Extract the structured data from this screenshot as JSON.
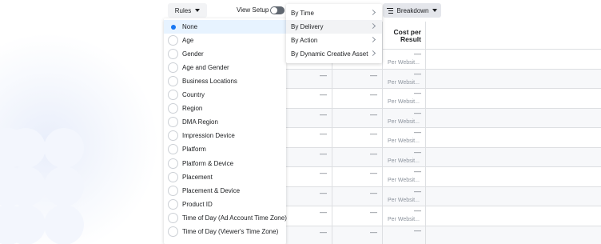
{
  "toolbar": {
    "rules_label": "Rules",
    "view_setup_label": "View Setup",
    "view_setup_on": false,
    "breakdown_label": "Breakdown"
  },
  "table": {
    "column_header_cost": "Cost per",
    "column_header_result": "Result",
    "empty_value": "—",
    "per_website_label": "Per Websit..."
  },
  "dropdown": {
    "selected_index": 0,
    "options": [
      {
        "label": "None"
      },
      {
        "label": "Age"
      },
      {
        "label": "Gender"
      },
      {
        "label": "Age and Gender"
      },
      {
        "label": "Business Locations"
      },
      {
        "label": "Country"
      },
      {
        "label": "Region"
      },
      {
        "label": "DMA Region"
      },
      {
        "label": "Impression Device"
      },
      {
        "label": "Platform"
      },
      {
        "label": "Platform & Device"
      },
      {
        "label": "Placement"
      },
      {
        "label": "Placement & Device"
      },
      {
        "label": "Product ID"
      },
      {
        "label": "Time of Day (Ad Account Time Zone)"
      },
      {
        "label": "Time of Day (Viewer's Time Zone)"
      }
    ]
  },
  "submenu": {
    "active_index": 1,
    "items": [
      {
        "label": "By Time"
      },
      {
        "label": "By Delivery"
      },
      {
        "label": "By Action"
      },
      {
        "label": "By Dynamic Creative Asset"
      }
    ]
  },
  "colors": {
    "accent": "#1877f2",
    "selected_bg": "#e7f3ff",
    "border": "#dddfe2",
    "muted_text": "#8d949e"
  }
}
